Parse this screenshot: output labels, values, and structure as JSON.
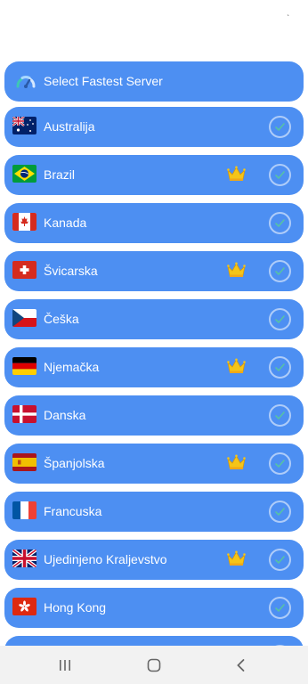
{
  "statusbar": {
    "indicator": "ˎ"
  },
  "servers": [
    {
      "label": "Select Fastest Server",
      "icon": "speedometer-icon",
      "premium": false,
      "check": false
    },
    {
      "label": "Australija",
      "flag": "australia-flag-icon",
      "premium": false,
      "check": true
    },
    {
      "label": "Brazil",
      "flag": "brazil-flag-icon",
      "premium": true,
      "check": true
    },
    {
      "label": "Kanada",
      "flag": "canada-flag-icon",
      "premium": false,
      "check": true
    },
    {
      "label": "Švicarska",
      "flag": "switzerland-flag-icon",
      "premium": true,
      "check": true
    },
    {
      "label": "Češka",
      "flag": "czechia-flag-icon",
      "premium": false,
      "check": true
    },
    {
      "label": "Njemačka",
      "flag": "germany-flag-icon",
      "premium": true,
      "check": true
    },
    {
      "label": "Danska",
      "flag": "denmark-flag-icon",
      "premium": false,
      "check": true
    },
    {
      "label": "Španjolska",
      "flag": "spain-flag-icon",
      "premium": true,
      "check": true
    },
    {
      "label": "Francuska",
      "flag": "france-flag-icon",
      "premium": false,
      "check": true
    },
    {
      "label": "Ujedinjeno Kraljevstvo",
      "flag": "uk-flag-icon",
      "premium": true,
      "check": true
    },
    {
      "label": "Hong Kong",
      "flag": "hongkong-flag-icon",
      "premium": false,
      "check": true
    }
  ],
  "colors": {
    "row_background": "#4d8ff2",
    "row_text": "#ffffff",
    "crown": "#f5c518",
    "navbar_background": "#f2f2f2"
  },
  "navbar": {
    "recent_apps": "recent-apps-icon",
    "home": "home-icon",
    "back": "back-icon"
  }
}
